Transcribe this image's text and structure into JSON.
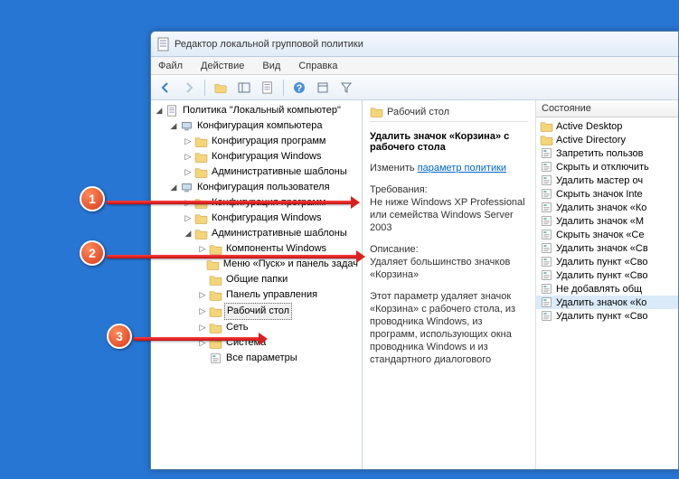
{
  "window": {
    "title": "Редактор локальной групповой политики"
  },
  "menu": {
    "file": "Файл",
    "action": "Действие",
    "view": "Вид",
    "help": "Справка"
  },
  "tree": {
    "root": "Политика \"Локальный компьютер\"",
    "computer_cfg": "Конфигурация компьютера",
    "cc_soft": "Конфигурация программ",
    "cc_win": "Конфигурация Windows",
    "cc_admin": "Административные шаблоны",
    "user_cfg": "Конфигурация пользователя",
    "uc_soft": "Конфигурация программ",
    "uc_win": "Конфигурация Windows",
    "uc_admin": "Административные шаблоны",
    "at_comp": "Компоненты Windows",
    "at_start": "Меню «Пуск» и панель задач",
    "at_shared": "Общие папки",
    "at_cp": "Панель управления",
    "at_desktop": "Рабочий стол",
    "at_net": "Сеть",
    "at_sys": "Система",
    "at_all": "Все параметры"
  },
  "detail": {
    "heading": "Рабочий стол",
    "item_title": "Удалить значок «Корзина» с рабочего стола",
    "edit_prefix": "Изменить ",
    "edit_link": "параметр политики",
    "req_label": "Требования:",
    "req_text": "Не ниже Windows XP Professional или семейства Windows Server 2003",
    "desc_label": "Описание:",
    "desc_text": "Удаляет большинство значков «Корзина»",
    "long_text": "Этот параметр удаляет значок «Корзина» с рабочего стола, из проводника Windows, из программ, использующих окна проводника Windows и из стандартного диалогового"
  },
  "list": {
    "col_state": "Состояние",
    "items": [
      {
        "t": "folder",
        "l": "Active Desktop"
      },
      {
        "t": "folder",
        "l": "Active Directory"
      },
      {
        "t": "set",
        "l": "Запретить пользов"
      },
      {
        "t": "set",
        "l": "Скрыть и отключить"
      },
      {
        "t": "set",
        "l": "Удалить мастер оч"
      },
      {
        "t": "set",
        "l": "Скрыть значок Inte"
      },
      {
        "t": "set",
        "l": "Удалить значок «Ко"
      },
      {
        "t": "set",
        "l": "Удалить значок «М"
      },
      {
        "t": "set",
        "l": "Скрыть значок «Се"
      },
      {
        "t": "set",
        "l": "Удалить значок «Св"
      },
      {
        "t": "set",
        "l": "Удалить пункт «Сво"
      },
      {
        "t": "set",
        "l": "Удалить пункт «Сво"
      },
      {
        "t": "set",
        "l": "Не добавлять общ"
      },
      {
        "t": "set",
        "l": "Удалить значок «Ко",
        "sel": true
      },
      {
        "t": "set",
        "l": "Удалить пункт «Сво"
      }
    ]
  },
  "markers": {
    "1": "1",
    "2": "2",
    "3": "3"
  }
}
